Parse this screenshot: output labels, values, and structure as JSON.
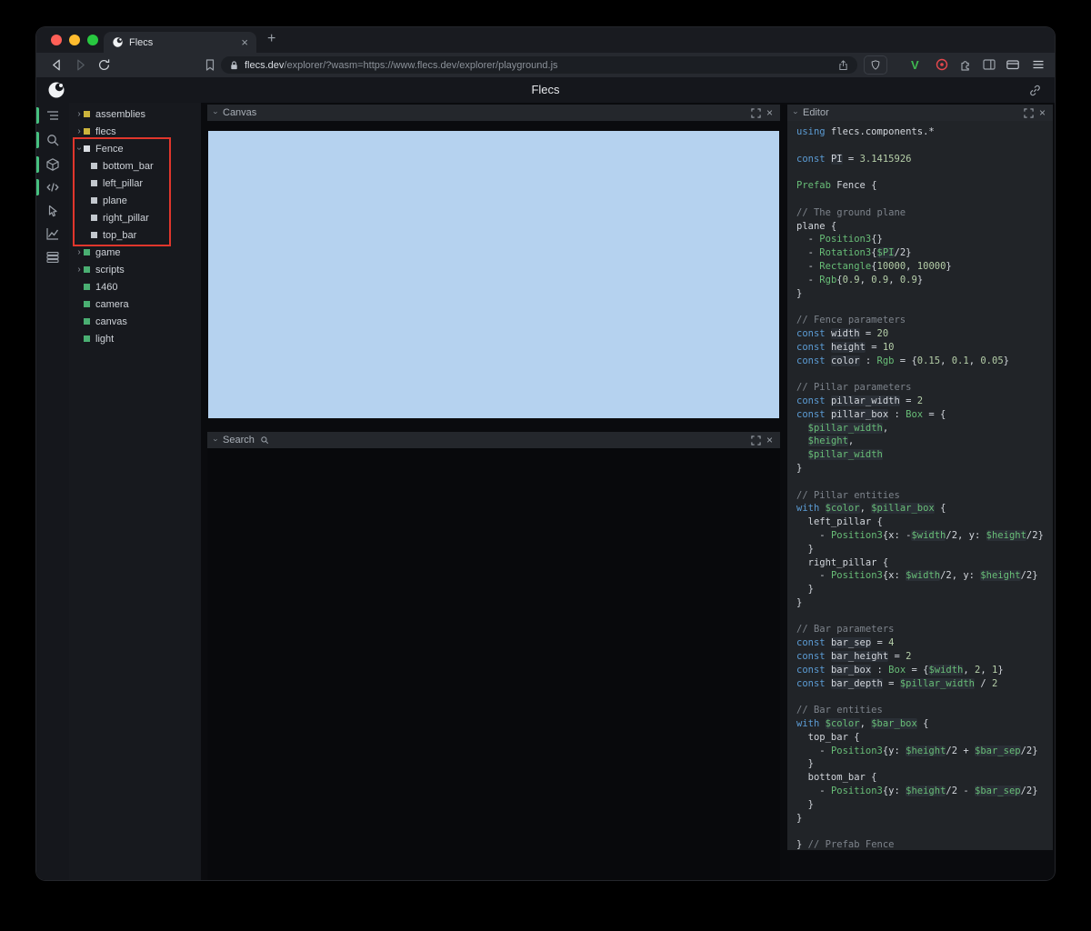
{
  "colors": {
    "traffic": [
      "#ff5f57",
      "#febc2e",
      "#28c840"
    ],
    "accent_green": "#46c07f",
    "canvas_blue": "#b5d2ef",
    "annotation_red": "#e0362c",
    "v_badge": "#3fb950",
    "record_red": "#e5484d",
    "squares": {
      "yellow": "#ccb43c",
      "green": "#4aaf72",
      "white": "#d9dde2",
      "gray": "#c3c8ce"
    }
  },
  "ui": {
    "chevron": "›",
    "close": "×",
    "new_tab": "+"
  },
  "browser": {
    "tab_title": "Flecs",
    "url_domain": "flecs.dev",
    "url_rest": "/explorer/?wasm=https://www.flecs.dev/explorer/playground.js"
  },
  "app": {
    "title": "Flecs"
  },
  "panels": {
    "canvas": {
      "title": "Canvas"
    },
    "search": {
      "title": "Search"
    },
    "editor": {
      "title": "Editor"
    }
  },
  "tree": {
    "items": [
      {
        "label": "assemblies",
        "depth": 0,
        "arrow": "collapsed",
        "square": "yellow"
      },
      {
        "label": "flecs",
        "depth": 0,
        "arrow": "collapsed",
        "square": "yellow"
      },
      {
        "label": "Fence",
        "depth": 0,
        "arrow": "expanded",
        "square": "white"
      },
      {
        "label": "bottom_bar",
        "depth": 1,
        "arrow": "",
        "square": "gray"
      },
      {
        "label": "left_pillar",
        "depth": 1,
        "arrow": "",
        "square": "gray"
      },
      {
        "label": "plane",
        "depth": 1,
        "arrow": "",
        "square": "gray"
      },
      {
        "label": "right_pillar",
        "depth": 1,
        "arrow": "",
        "square": "gray"
      },
      {
        "label": "top_bar",
        "depth": 1,
        "arrow": "",
        "square": "gray"
      },
      {
        "label": "game",
        "depth": 0,
        "arrow": "collapsed",
        "square": "green"
      },
      {
        "label": "scripts",
        "depth": 0,
        "arrow": "collapsed",
        "square": "green"
      },
      {
        "label": "1460",
        "depth": 0,
        "arrow": "",
        "square": "green"
      },
      {
        "label": "camera",
        "depth": 0,
        "arrow": "",
        "square": "green"
      },
      {
        "label": "canvas",
        "depth": 0,
        "arrow": "",
        "square": "green"
      },
      {
        "label": "light",
        "depth": 0,
        "arrow": "",
        "square": "green"
      }
    ]
  },
  "editor": {
    "lines": [
      [
        [
          "kw",
          "using"
        ],
        [
          "p",
          " flecs.components.*"
        ]
      ],
      [],
      [
        [
          "kw",
          "const"
        ],
        [
          "p",
          " "
        ],
        [
          "def",
          "PI"
        ],
        [
          "p",
          " = "
        ],
        [
          "num",
          "3.1415926"
        ]
      ],
      [],
      [
        [
          "type",
          "Prefab"
        ],
        [
          "p",
          " Fence {"
        ]
      ],
      [],
      [
        [
          "c",
          "// The ground plane"
        ]
      ],
      [
        [
          "p",
          "plane {"
        ]
      ],
      [
        [
          "p",
          "  - "
        ],
        [
          "type",
          "Position3"
        ],
        [
          "p",
          "{}"
        ]
      ],
      [
        [
          "p",
          "  - "
        ],
        [
          "type",
          "Rotation3"
        ],
        [
          "p",
          "{"
        ],
        [
          "var",
          "$PI"
        ],
        [
          "p",
          "/2}"
        ]
      ],
      [
        [
          "p",
          "  - "
        ],
        [
          "type",
          "Rectangle"
        ],
        [
          "p",
          "{"
        ],
        [
          "num",
          "10000"
        ],
        [
          "p",
          ", "
        ],
        [
          "num",
          "10000"
        ],
        [
          "p",
          "}"
        ]
      ],
      [
        [
          "p",
          "  - "
        ],
        [
          "type",
          "Rgb"
        ],
        [
          "p",
          "{"
        ],
        [
          "num",
          "0.9"
        ],
        [
          "p",
          ", "
        ],
        [
          "num",
          "0.9"
        ],
        [
          "p",
          ", "
        ],
        [
          "num",
          "0.9"
        ],
        [
          "p",
          "}"
        ]
      ],
      [
        [
          "p",
          "}"
        ]
      ],
      [],
      [
        [
          "c",
          "// Fence parameters"
        ]
      ],
      [
        [
          "kw",
          "const"
        ],
        [
          "p",
          " "
        ],
        [
          "def",
          "width"
        ],
        [
          "p",
          " = "
        ],
        [
          "num",
          "20"
        ]
      ],
      [
        [
          "kw",
          "const"
        ],
        [
          "p",
          " "
        ],
        [
          "def",
          "height"
        ],
        [
          "p",
          " = "
        ],
        [
          "num",
          "10"
        ]
      ],
      [
        [
          "kw",
          "const"
        ],
        [
          "p",
          " "
        ],
        [
          "def",
          "color"
        ],
        [
          "p",
          " : "
        ],
        [
          "type",
          "Rgb"
        ],
        [
          "p",
          " = {"
        ],
        [
          "num",
          "0.15"
        ],
        [
          "p",
          ", "
        ],
        [
          "num",
          "0.1"
        ],
        [
          "p",
          ", "
        ],
        [
          "num",
          "0.05"
        ],
        [
          "p",
          "}"
        ]
      ],
      [],
      [
        [
          "c",
          "// Pillar parameters"
        ]
      ],
      [
        [
          "kw",
          "const"
        ],
        [
          "p",
          " "
        ],
        [
          "def",
          "pillar_width"
        ],
        [
          "p",
          " = "
        ],
        [
          "num",
          "2"
        ]
      ],
      [
        [
          "kw",
          "const"
        ],
        [
          "p",
          " "
        ],
        [
          "def",
          "pillar_box"
        ],
        [
          "p",
          " : "
        ],
        [
          "type",
          "Box"
        ],
        [
          "p",
          " = {"
        ]
      ],
      [
        [
          "p",
          "  "
        ],
        [
          "var",
          "$pillar_width"
        ],
        [
          "p",
          ","
        ]
      ],
      [
        [
          "p",
          "  "
        ],
        [
          "var",
          "$height"
        ],
        [
          "p",
          ","
        ]
      ],
      [
        [
          "p",
          "  "
        ],
        [
          "var",
          "$pillar_width"
        ]
      ],
      [
        [
          "p",
          "}"
        ]
      ],
      [],
      [
        [
          "c",
          "// Pillar entities"
        ]
      ],
      [
        [
          "kw",
          "with"
        ],
        [
          "p",
          " "
        ],
        [
          "var",
          "$color"
        ],
        [
          "p",
          ", "
        ],
        [
          "var",
          "$pillar_box"
        ],
        [
          "p",
          " {"
        ]
      ],
      [
        [
          "p",
          "  left_pillar {"
        ]
      ],
      [
        [
          "p",
          "    - "
        ],
        [
          "type",
          "Position3"
        ],
        [
          "p",
          "{x: -"
        ],
        [
          "var",
          "$width"
        ],
        [
          "p",
          "/2, y: "
        ],
        [
          "var",
          "$height"
        ],
        [
          "p",
          "/2}"
        ]
      ],
      [
        [
          "p",
          "  }"
        ]
      ],
      [
        [
          "p",
          "  right_pillar {"
        ]
      ],
      [
        [
          "p",
          "    - "
        ],
        [
          "type",
          "Position3"
        ],
        [
          "p",
          "{x: "
        ],
        [
          "var",
          "$width"
        ],
        [
          "p",
          "/2, y: "
        ],
        [
          "var",
          "$height"
        ],
        [
          "p",
          "/2}"
        ]
      ],
      [
        [
          "p",
          "  }"
        ]
      ],
      [
        [
          "p",
          "}"
        ]
      ],
      [],
      [
        [
          "c",
          "// Bar parameters"
        ]
      ],
      [
        [
          "kw",
          "const"
        ],
        [
          "p",
          " "
        ],
        [
          "def",
          "bar_sep"
        ],
        [
          "p",
          " = "
        ],
        [
          "num",
          "4"
        ]
      ],
      [
        [
          "kw",
          "const"
        ],
        [
          "p",
          " "
        ],
        [
          "def",
          "bar_height"
        ],
        [
          "p",
          " = "
        ],
        [
          "num",
          "2"
        ]
      ],
      [
        [
          "kw",
          "const"
        ],
        [
          "p",
          " "
        ],
        [
          "def",
          "bar_box"
        ],
        [
          "p",
          " : "
        ],
        [
          "type",
          "Box"
        ],
        [
          "p",
          " = {"
        ],
        [
          "var",
          "$width"
        ],
        [
          "p",
          ", "
        ],
        [
          "num",
          "2"
        ],
        [
          "p",
          ", "
        ],
        [
          "num",
          "1"
        ],
        [
          "p",
          "}"
        ]
      ],
      [
        [
          "kw",
          "const"
        ],
        [
          "p",
          " "
        ],
        [
          "def",
          "bar_depth"
        ],
        [
          "p",
          " = "
        ],
        [
          "var",
          "$pillar_width"
        ],
        [
          "p",
          " / "
        ],
        [
          "num",
          "2"
        ]
      ],
      [],
      [
        [
          "c",
          "// Bar entities"
        ]
      ],
      [
        [
          "kw",
          "with"
        ],
        [
          "p",
          " "
        ],
        [
          "var",
          "$color"
        ],
        [
          "p",
          ", "
        ],
        [
          "var",
          "$bar_box"
        ],
        [
          "p",
          " {"
        ]
      ],
      [
        [
          "p",
          "  top_bar {"
        ]
      ],
      [
        [
          "p",
          "    - "
        ],
        [
          "type",
          "Position3"
        ],
        [
          "p",
          "{y: "
        ],
        [
          "var",
          "$height"
        ],
        [
          "p",
          "/2 + "
        ],
        [
          "var",
          "$bar_sep"
        ],
        [
          "p",
          "/2}"
        ]
      ],
      [
        [
          "p",
          "  }"
        ]
      ],
      [
        [
          "p",
          "  bottom_bar {"
        ]
      ],
      [
        [
          "p",
          "    - "
        ],
        [
          "type",
          "Position3"
        ],
        [
          "p",
          "{y: "
        ],
        [
          "var",
          "$height"
        ],
        [
          "p",
          "/2 - "
        ],
        [
          "var",
          "$bar_sep"
        ],
        [
          "p",
          "/2}"
        ]
      ],
      [
        [
          "p",
          "  }"
        ]
      ],
      [
        [
          "p",
          "}"
        ]
      ],
      [],
      [
        [
          "p",
          "} "
        ],
        [
          "c",
          "// Prefab Fence"
        ]
      ]
    ]
  }
}
